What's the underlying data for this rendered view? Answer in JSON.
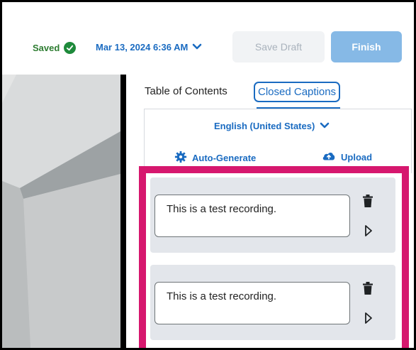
{
  "header": {
    "saved_label": "Saved",
    "date_label": "Mar 13, 2024 6:36 AM",
    "save_draft_label": "Save Draft",
    "finish_label": "Finish"
  },
  "tabs": [
    {
      "label": "Table of Contents",
      "active": false
    },
    {
      "label": "Closed Captions",
      "active": true
    }
  ],
  "captions": {
    "language_label": "English (United States)",
    "auto_generate_label": "Auto-Generate",
    "upload_label": "Upload",
    "cues": [
      {
        "text": "This is a test recording."
      },
      {
        "text": "This is a test recording."
      }
    ]
  },
  "colors": {
    "accent": "#1a6bc1",
    "success": "#1e8a3b",
    "highlight": "#d6176e",
    "finish_button": "#86b9e6"
  },
  "icons": {
    "saved": "check-circle-icon",
    "date_dropdown": "chevron-down-icon",
    "language_dropdown": "chevron-down-icon",
    "auto_generate": "gear-icon",
    "upload": "cloud-upload-icon",
    "delete": "trash-icon",
    "play": "play-icon"
  }
}
